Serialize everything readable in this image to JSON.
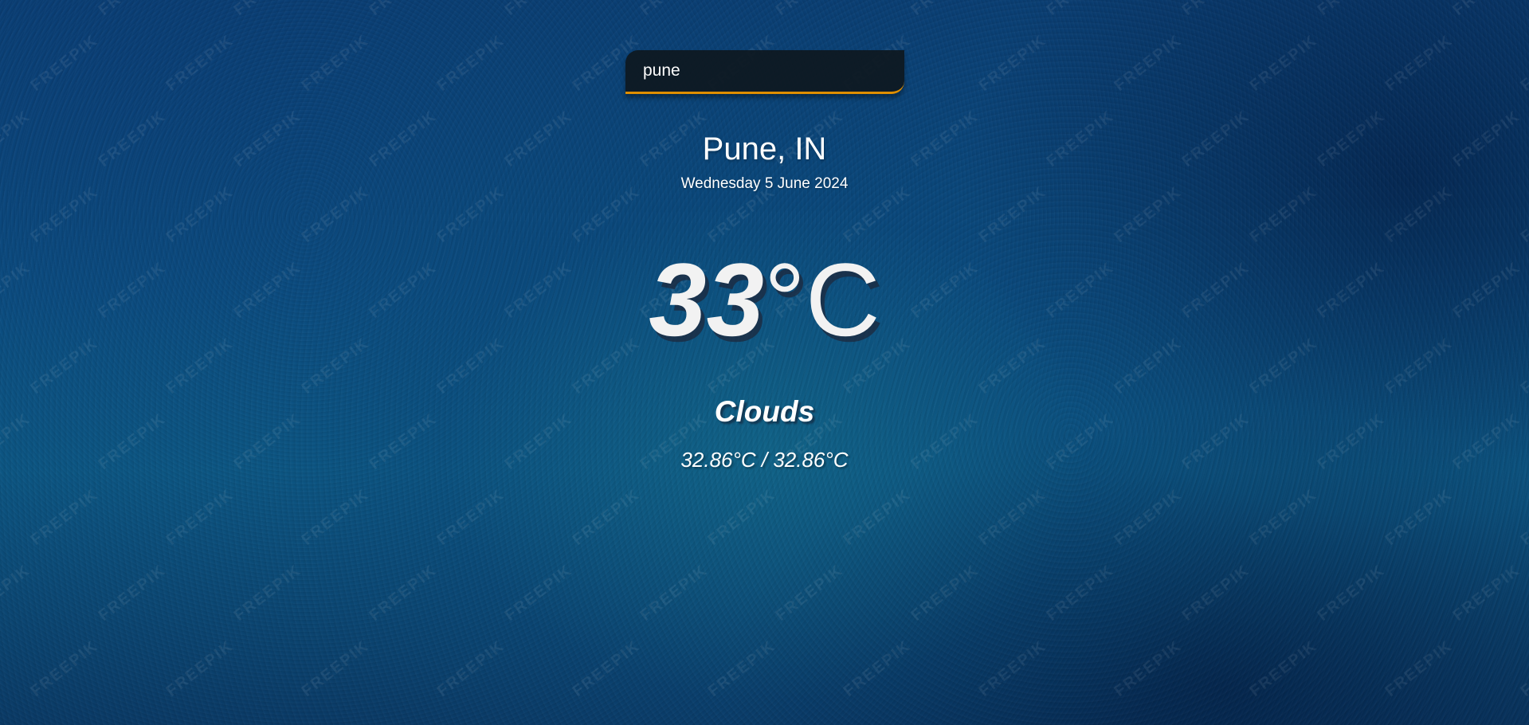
{
  "search": {
    "value": "pune",
    "accent_color": "#df8e00"
  },
  "location": {
    "city_country": "Pune, IN",
    "date": "Wednesday 5 June 2024"
  },
  "temperature": {
    "value": "33",
    "unit": "°C"
  },
  "weather": {
    "condition": "Clouds",
    "hi_low": "32.86°C / 32.86°C"
  },
  "background": {
    "watermark_text": "FREEPIK",
    "base_color": "#0b4c80"
  }
}
